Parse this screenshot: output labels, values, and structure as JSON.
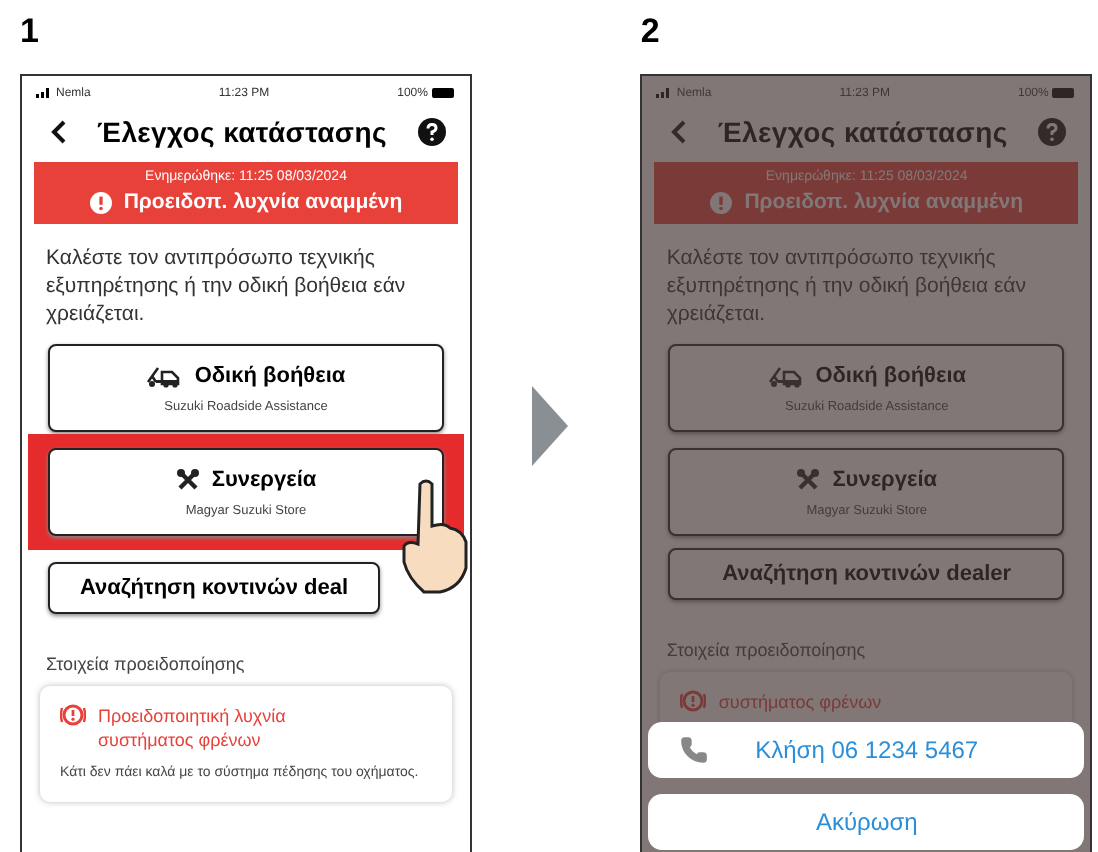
{
  "steps": [
    {
      "number": "1",
      "dimmed": false,
      "screen": {
        "status_bar": {
          "carrier": "Nemla",
          "time": "11:23 PM",
          "battery": "100%"
        },
        "title": "Έλεγχος κατάστασης",
        "alert": {
          "updated": "Ενημερώθηκε: 11:25 08/03/2024",
          "message": "Προειδοπ. λυχνία αναμμένη"
        },
        "instructions": "Καλέστε τον αντιπρόσωπο τεχνικής εξυπηρέτησης ή την οδική βοήθεια εάν χρειάζεται.",
        "buttons": [
          {
            "kind": "roadside",
            "title": "Οδική βοήθεια",
            "subtitle": "Suzuki Roadside Assistance",
            "highlighted": false
          },
          {
            "kind": "workshop",
            "title": "Συνεργεία",
            "subtitle": "Magyar Suzuki Store",
            "highlighted": true
          }
        ],
        "dealer_button": "Αναζήτηση κοντινών deal",
        "section_label": "Στοιχεία προειδοποίησης",
        "warning": {
          "title_lines": [
            "Προειδοποιητική λυχνία",
            "συστήματος φρένων"
          ],
          "description": "Κάτι δεν πάει καλά με το σύστημα πέδησης του οχήματος."
        }
      }
    },
    {
      "number": "2",
      "dimmed": true,
      "screen": {
        "status_bar": {
          "carrier": "Nemla",
          "time": "11:23 PM",
          "battery": "100%"
        },
        "title": "Έλεγχος κατάστασης",
        "alert": {
          "updated": "Ενημερώθηκε: 11:25 08/03/2024",
          "message": "Προειδοπ. λυχνία αναμμένη"
        },
        "instructions": "Καλέστε τον αντιπρόσωπο τεχνικής εξυπηρέτησης ή την οδική βοήθεια εάν χρειάζεται.",
        "buttons": [
          {
            "kind": "roadside",
            "title": "Οδική βοήθεια",
            "subtitle": "Suzuki Roadside Assistance",
            "highlighted": false
          },
          {
            "kind": "workshop",
            "title": "Συνεργεία",
            "subtitle": "Magyar Suzuki Store",
            "highlighted": false
          }
        ],
        "dealer_button": "Αναζήτηση κοντινών dealer",
        "section_label": "Στοιχεία προειδοποίησης",
        "warning": {
          "title_lines": [
            "συστήματος φρένων"
          ]
        }
      },
      "action_sheet": {
        "call": "Κλήση 06 1234 5467",
        "cancel": "Ακύρωση"
      }
    }
  ]
}
